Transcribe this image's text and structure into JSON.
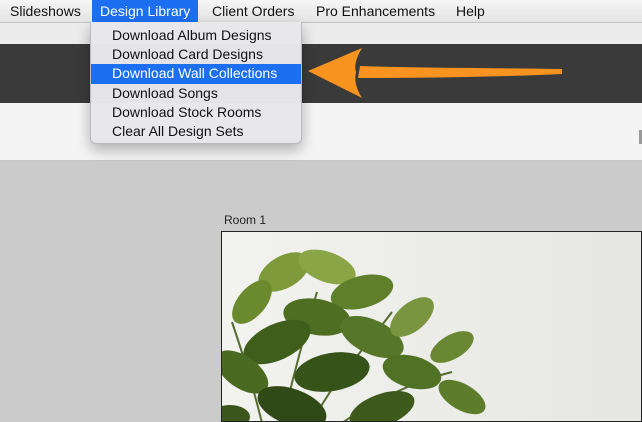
{
  "menubar": {
    "items": [
      {
        "label": "Slideshows"
      },
      {
        "label": "Design Library"
      },
      {
        "label": "Client Orders"
      },
      {
        "label": "Pro Enhancements"
      },
      {
        "label": "Help"
      }
    ],
    "active_index": 1
  },
  "dropdown": {
    "items": [
      {
        "label": "Download Album Designs"
      },
      {
        "label": "Download Card Designs"
      },
      {
        "label": "Download Wall Collections"
      },
      {
        "label": "Download Songs"
      },
      {
        "label": "Download Stock Rooms"
      },
      {
        "label": "Clear All Design Sets"
      }
    ],
    "highlighted_index": 2
  },
  "canvas": {
    "room_label": "Room 1"
  },
  "colors": {
    "menu_highlight": "#1d6ff2",
    "annotation_arrow": "#f7931e",
    "toolbar_dark": "#3a3a3a"
  }
}
